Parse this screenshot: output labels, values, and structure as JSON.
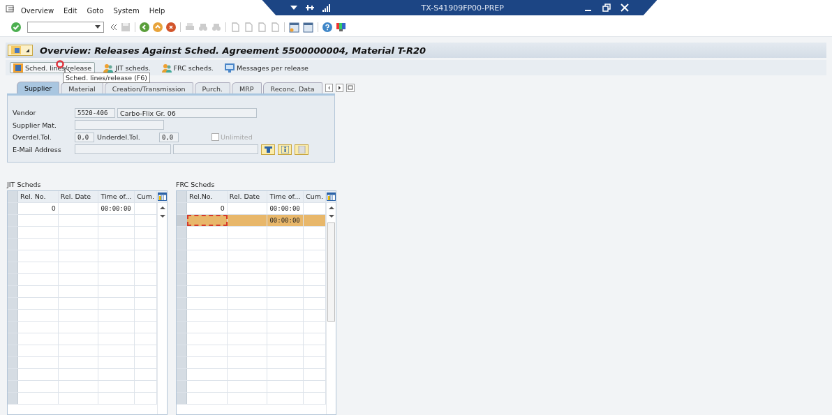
{
  "menu": [
    "Overview",
    "Edit",
    "Goto",
    "System",
    "Help"
  ],
  "window": {
    "title": "TX-S41909FP00-PREP"
  },
  "title": "Overview: Releases Against Sched. Agreement 5500000004, Material T-R20",
  "app_toolbar": [
    "Sched. lines/release",
    "JIT scheds.",
    "FRC scheds.",
    "Messages per release"
  ],
  "tooltip": "Sched. lines/release   (F6)",
  "tabs": [
    {
      "label": "Supplier",
      "selected": true
    },
    {
      "label": "Material",
      "selected": false
    },
    {
      "label": "Creation/Transmission",
      "selected": false
    },
    {
      "label": "Purch.",
      "selected": false
    },
    {
      "label": "MRP",
      "selected": false
    },
    {
      "label": "Reconc. Data",
      "selected": false
    }
  ],
  "vendor": {
    "label": "Vendor",
    "code": "5520-406",
    "name": "Carbo-Flix Gr. 06"
  },
  "supplier_mat": {
    "label": "Supplier Mat."
  },
  "overdel": {
    "label": "Overdel.Tol.",
    "value": "0,0"
  },
  "underdel": {
    "label": "Underdel.Tol.",
    "value": "0,0"
  },
  "unlimited": {
    "label": "Unlimited",
    "checked": false,
    "disabled": true
  },
  "email": {
    "label": "E-Mail Address"
  },
  "tables": [
    {
      "title": "JIT Scheds",
      "columns": [
        "Rel. No.",
        "Rel. Date",
        "Time of...",
        "Cum."
      ],
      "rows": [
        {
          "cells": [
            "0",
            "",
            "00:00:00",
            ""
          ],
          "selected": false
        }
      ]
    },
    {
      "title": "FRC Scheds",
      "columns": [
        "Rel.No.",
        "Rel. Date",
        "Time of...",
        "Cum."
      ],
      "rows": [
        {
          "cells": [
            "0",
            "",
            "00:00:00",
            ""
          ],
          "selected": false
        },
        {
          "cells": [
            "",
            "",
            "00:00:00",
            ""
          ],
          "selected": true
        }
      ]
    }
  ]
}
